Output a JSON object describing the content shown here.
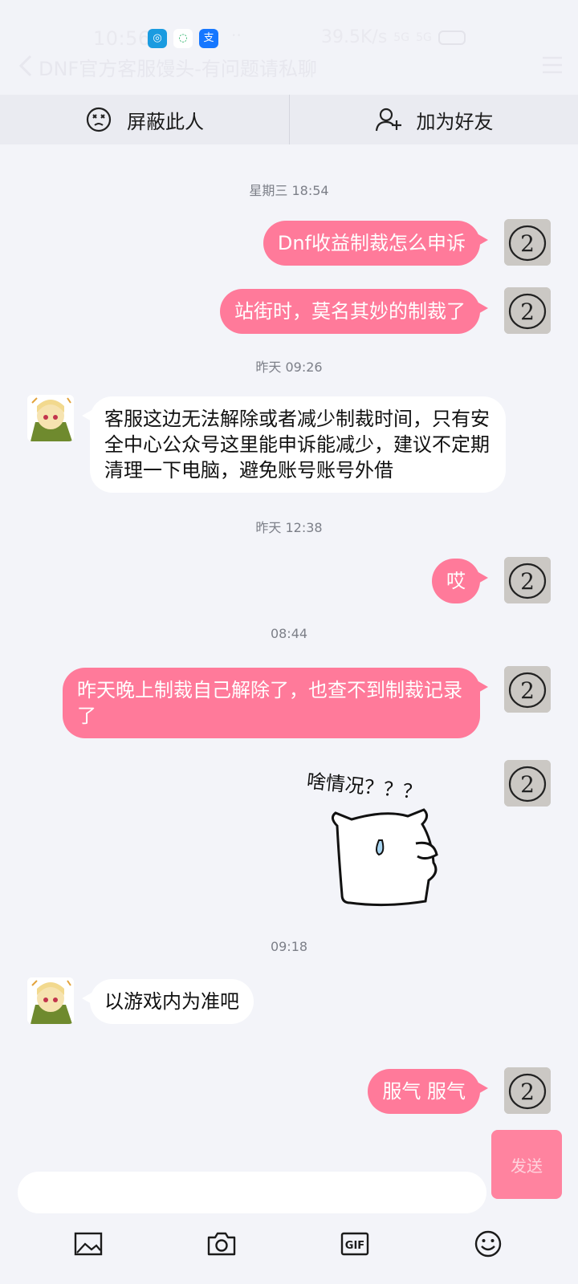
{
  "status_bar": {
    "time": "10:56",
    "network_speed": "39.5K/s",
    "signal_1": "5G",
    "signal_2": "5G",
    "battery": "100"
  },
  "header": {
    "title": "DNF官方客服馒头-有问题请私聊"
  },
  "actions": {
    "block_label": "屏蔽此人",
    "add_friend_label": "加为好友"
  },
  "messages": [
    {
      "type": "time",
      "text": "星期三 18:54"
    },
    {
      "type": "me",
      "text": "Dnf收益制裁怎么申诉"
    },
    {
      "type": "me",
      "text": "站街时，莫名其妙的制裁了"
    },
    {
      "type": "time",
      "text": "昨天 09:26"
    },
    {
      "type": "other",
      "text": "客服这边无法解除或者减少制裁时间，只有安全中心公众号这里能申诉能减少，建议不定期清理一下电脑，避免账号账号外借"
    },
    {
      "type": "time",
      "text": "昨天 12:38"
    },
    {
      "type": "me",
      "text": "哎"
    },
    {
      "type": "time",
      "text": "08:44"
    },
    {
      "type": "me",
      "text": "昨天晚上制裁自己解除了，也查不到制裁记录了"
    },
    {
      "type": "sticker",
      "caption": "啥情况？？？"
    },
    {
      "type": "time",
      "text": "09:18"
    },
    {
      "type": "other",
      "text": "以游戏内为准吧"
    },
    {
      "type": "me",
      "text": "服气 服气"
    }
  ],
  "avatar_me_text": "2",
  "composer": {
    "send_label": "发送",
    "input_value": "",
    "toolbar_icons": [
      "image-icon",
      "camera-icon",
      "gif-icon",
      "emoji-icon"
    ],
    "gif_label": "GIF"
  },
  "colors": {
    "my_bubble": "#ff7a9a",
    "other_bubble": "#ffffff",
    "background": "#f3f4f9"
  }
}
